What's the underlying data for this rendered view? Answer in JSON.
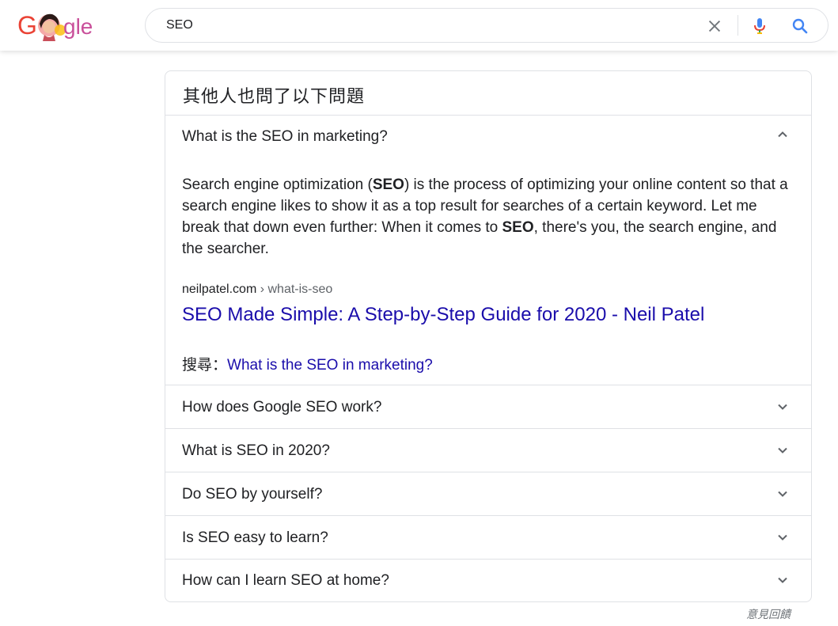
{
  "header": {
    "search_value": "SEO",
    "brand_colors": {
      "blue": "#4285f4",
      "red": "#ea4335",
      "yellow": "#fbbc05",
      "green": "#34a853"
    }
  },
  "paa": {
    "title": "其他人也問了以下問題",
    "expanded": {
      "question": "What is the SEO in marketing?",
      "answer_parts": [
        "Search engine optimization (",
        "SEO",
        ") is the process of optimizing your online content so that a search engine likes to show it as a top result for searches of a certain keyword. Let me break that down even further: When it comes to ",
        "SEO",
        ", there's you, the search engine, and the searcher."
      ],
      "cite_domain": "neilpatel.com",
      "cite_path": " › what-is-seo",
      "result_title": "SEO Made Simple: A Step-by-Step Guide for 2020 - Neil Patel",
      "search_for_label": "搜尋：",
      "search_for_query": "What is the SEO in marketing?"
    },
    "questions": [
      "How does Google SEO work?",
      "What is SEO in 2020?",
      "Do SEO by yourself?",
      "Is SEO easy to learn?",
      "How can I learn SEO at home?"
    ]
  },
  "footer": {
    "feedback_label": "意見回饋"
  }
}
